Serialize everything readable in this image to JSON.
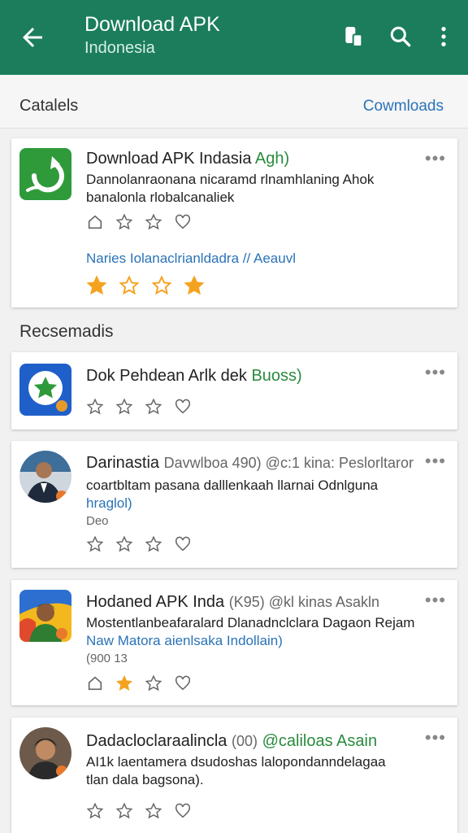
{
  "appbar": {
    "title": "Download APK",
    "subtitle": "Indonesia"
  },
  "subbar": {
    "left": "Catalels",
    "right": "Cowmloads"
  },
  "featured": {
    "name": "Download APK Indasia",
    "name_tag": "Agh)",
    "desc_line1": "Dannolanraonana nicaramd rlnamhlaning Ahok",
    "desc_line2": "banalonla rlobalcanaliek",
    "link": "Naries Iolanaclrianldadra // Aeauvl",
    "rating_stars_filled": [
      true,
      false,
      false,
      true
    ],
    "colors": {
      "star": "#f4a320",
      "icon_bg": "#2f9a3a"
    }
  },
  "section_recommended": "Recsemadis",
  "apps": [
    {
      "name": "Dok Pehdean Arlk dek",
      "name_tag": "Buoss)",
      "desc_line1": "",
      "desc_line2": "",
      "count": "",
      "stars": [
        false,
        false,
        false
      ],
      "heart": false
    },
    {
      "name": "Darinastia",
      "name_meta": "Davwlboa 490) @c:1 kina: Peslorltaror",
      "desc_line1": "coartbltam pasana dalllenkaah llarnai Odnlguna",
      "desc_line2": "hraglol)",
      "count": "Deo",
      "stars": [
        false,
        false,
        false
      ],
      "heart": false
    },
    {
      "name": "Hodaned APK Inda",
      "name_meta": "(K95) @kl kinas Asakln",
      "desc_line1": "Mostentlanbeafaralard Dlanadnclclara Dagaon Rejam",
      "desc_line2": "Naw Matora aienlsaka Indollain)",
      "count": "(900 13",
      "stars": [
        false,
        true,
        false
      ],
      "heart": false
    },
    {
      "name": "Dadacloclaraalincla",
      "name_meta": "(00)",
      "name_tag": "@caliloas Asain",
      "desc_line1": "AI1k laentamera dsudoshas lalopondanndelagaa",
      "desc_line2": "tlan dala bagsona).",
      "count": "",
      "stars": [
        false,
        false,
        false
      ],
      "heart": false
    }
  ]
}
